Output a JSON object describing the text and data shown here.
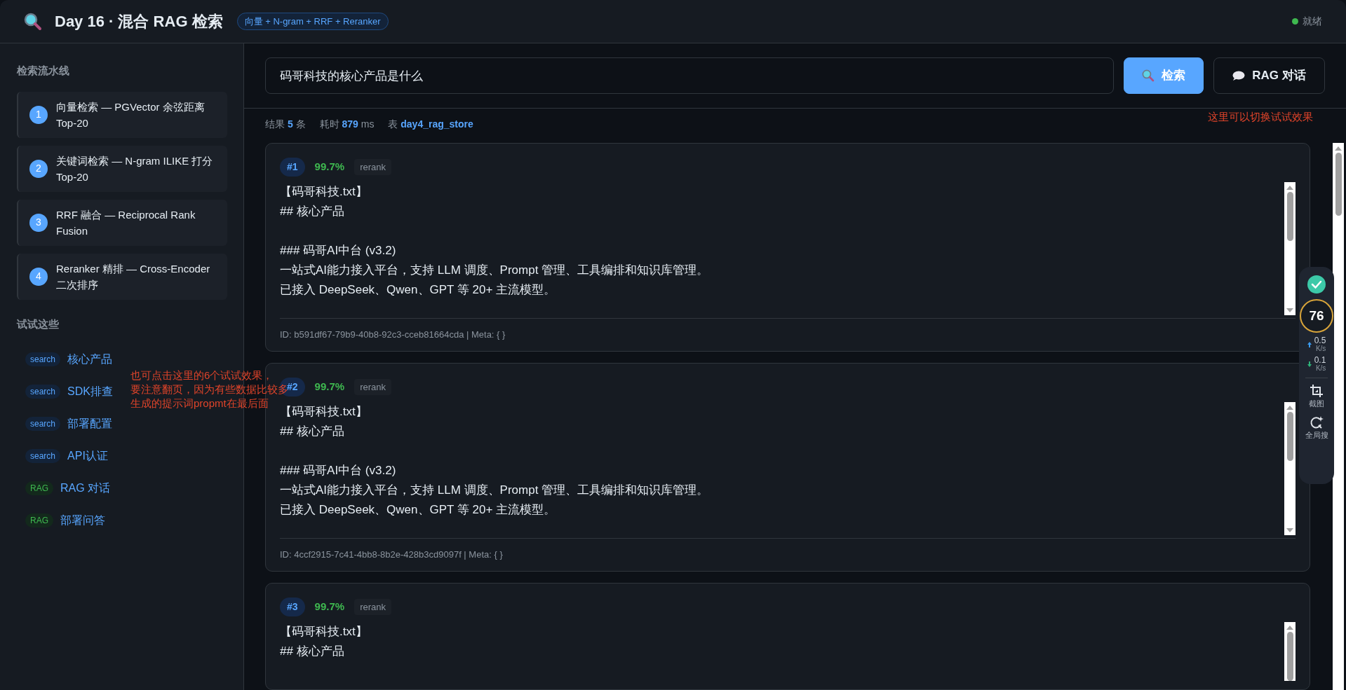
{
  "header": {
    "title": "Day 16 · 混合 RAG 检索",
    "badge": "向量 + N-gram + RRF + Reranker",
    "status": "就绪"
  },
  "sidebar": {
    "pipeline_title": "检索流水线",
    "pipeline": [
      {
        "number": "1",
        "text": "向量检索 — PGVector 余弦距离 Top-20"
      },
      {
        "number": "2",
        "text": "关键词检索 — N-gram ILIKE 打分 Top-20"
      },
      {
        "number": "3",
        "text": "RRF 融合 — Reciprocal Rank Fusion"
      },
      {
        "number": "4",
        "text": "Reranker 精排 — Cross-Encoder 二次排序"
      }
    ],
    "try_title": "试试这些",
    "try_items": [
      {
        "kind": "search",
        "tag": "search",
        "label": "核心产品"
      },
      {
        "kind": "search",
        "tag": "search",
        "label": "SDK排查"
      },
      {
        "kind": "search",
        "tag": "search",
        "label": "部署配置"
      },
      {
        "kind": "search",
        "tag": "search",
        "label": "API认证"
      },
      {
        "kind": "rag",
        "tag": "RAG",
        "label": "RAG 对话"
      },
      {
        "kind": "rag",
        "tag": "RAG",
        "label": "部署问答"
      }
    ]
  },
  "search": {
    "value": "码哥科技的核心产品是什么",
    "buttons": [
      {
        "kind": "primary",
        "label": "检索"
      },
      {
        "kind": "secondary",
        "label": "RAG 对话"
      }
    ]
  },
  "stats": {
    "count_label": "结果",
    "count": "5",
    "count_unit": "条",
    "time_label": "耗时",
    "time": "879",
    "time_unit": "ms",
    "table_label": "表",
    "table": "day4_rag_store"
  },
  "results": [
    {
      "rank": "#1",
      "score": "99.7%",
      "method": "rerank",
      "blocks": [
        [
          "【码哥科技.txt】",
          "## 核心产品"
        ],
        [
          "### 码哥AI中台 (v3.2)",
          "一站式AI能力接入平台，支持 LLM 调度、Prompt 管理、工具编排和知识库管理。",
          "已接入 DeepSeek、Qwen、GPT 等 20+ 主流模型。"
        ]
      ],
      "footer": "ID: b591df67-79b9-40b8-92c3-cceb81664cda | Meta: { }"
    },
    {
      "rank": "#2",
      "score": "99.7%",
      "method": "rerank",
      "blocks": [
        [
          "【码哥科技.txt】",
          "## 核心产品"
        ],
        [
          "### 码哥AI中台 (v3.2)",
          "一站式AI能力接入平台，支持 LLM 调度、Prompt 管理、工具编排和知识库管理。",
          "已接入 DeepSeek、Qwen、GPT 等 20+ 主流模型。"
        ]
      ],
      "footer": "ID: 4ccf2915-7c41-4bb8-8b2e-428b3cd9097f | Meta: { }"
    },
    {
      "rank": "#3",
      "score": "99.7%",
      "method": "rerank",
      "blocks": [
        [
          "【码哥科技.txt】",
          "## 核心产品"
        ]
      ]
    }
  ],
  "annotations": {
    "buttons_note": "这里可以切换试试效果",
    "sidebar_note": [
      "也可点击这里的6个试试效果，",
      "要注意翻页，因为有些数据比较多",
      "生成的提示词propmt在最后面"
    ]
  },
  "widget": {
    "score": "76",
    "upload": {
      "value": "0.5",
      "unit": "K/s"
    },
    "download": {
      "value": "0.1",
      "unit": "K/s"
    },
    "tools": [
      {
        "kind": "crop",
        "label": "截图"
      },
      {
        "kind": "search",
        "label": "全局搜"
      }
    ]
  }
}
